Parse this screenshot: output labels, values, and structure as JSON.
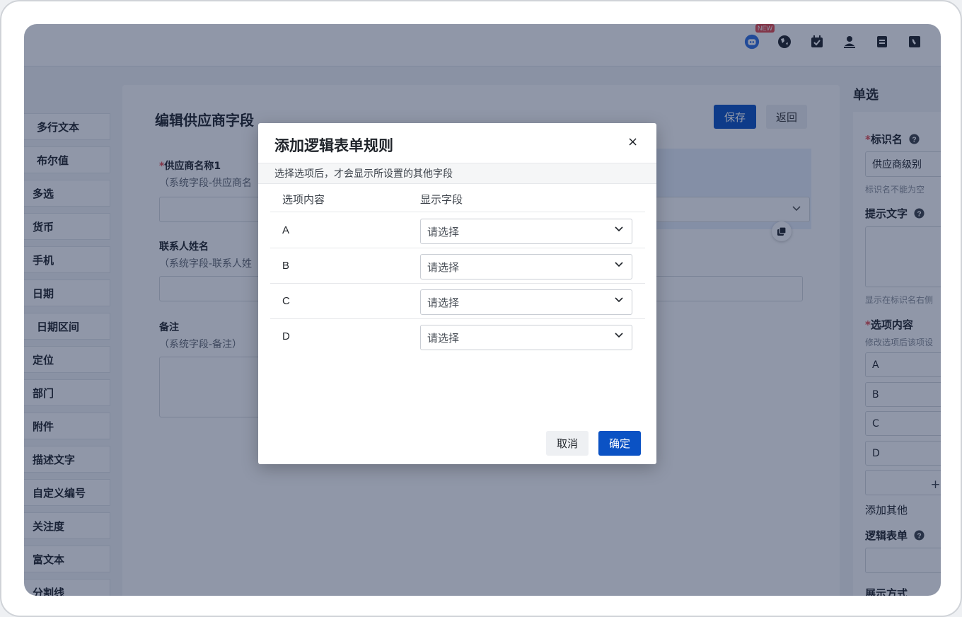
{
  "topbar": {
    "new_badge": "NEW",
    "icons": [
      "robot-icon",
      "globe-icon",
      "calendar-icon",
      "user-icon",
      "document-icon",
      "contacts-icon"
    ]
  },
  "sidebar": {
    "items": [
      {
        "label": "多行文本"
      },
      {
        "label": "布尔值"
      },
      {
        "label": "多选"
      },
      {
        "label": "货币"
      },
      {
        "label": "手机"
      },
      {
        "label": "日期"
      },
      {
        "label": "日期区间"
      },
      {
        "label": "定位"
      },
      {
        "label": "部门"
      },
      {
        "label": "附件"
      },
      {
        "label": "描述文字"
      },
      {
        "label": "自定义编号"
      },
      {
        "label": "关注度"
      },
      {
        "label": "富文本"
      },
      {
        "label": "分割线"
      }
    ]
  },
  "main": {
    "title": "编辑供应商字段",
    "save_label": "保存",
    "back_label": "返回",
    "fields": [
      {
        "required_mark": "*",
        "label": "供应商名称1",
        "sub": "（系统字段-供应商名"
      },
      {
        "required_mark": "",
        "label": "联系人姓名",
        "sub": "（系统字段-联系人姓"
      },
      {
        "required_mark": "",
        "label": "备注",
        "sub": "（系统字段-备注）"
      }
    ]
  },
  "right_panel": {
    "title": "单选",
    "identifier_label": "标识名",
    "identifier_value": "供应商级别",
    "identifier_hint": "标识名不能为空",
    "prompt_label": "提示文字",
    "prompt_hint": "显示在标识名右侧",
    "options_label": "选项内容",
    "options_hint": "修改选项后该项设",
    "options": [
      "A",
      "B",
      "C",
      "D"
    ],
    "add_text": "+ 添",
    "add_other": "添加其他",
    "logic_label": "逻辑表单",
    "display_label": "展示方式"
  },
  "modal": {
    "title": "添加逻辑表单规则",
    "close_glyph": "×",
    "description": "选择选项后，才会显示所设置的其他字段",
    "col_option": "选项内容",
    "col_field": "显示字段",
    "rows": [
      {
        "option": "A",
        "select_value": "请选择"
      },
      {
        "option": "B",
        "select_value": "请选择"
      },
      {
        "option": "C",
        "select_value": "请选择"
      },
      {
        "option": "D",
        "select_value": "请选择"
      }
    ],
    "cancel_label": "取消",
    "ok_label": "确定"
  }
}
